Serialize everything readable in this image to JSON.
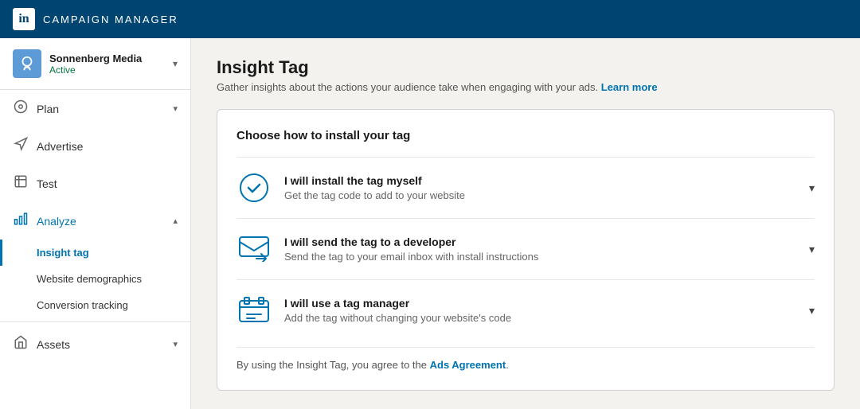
{
  "topNav": {
    "logoText": "in",
    "title": "CAMPAIGN MANAGER"
  },
  "sidebar": {
    "account": {
      "name": "Sonnenberg Media",
      "status": "Active"
    },
    "items": [
      {
        "id": "plan",
        "label": "Plan",
        "icon": "⊙",
        "hasChevron": true
      },
      {
        "id": "advertise",
        "label": "Advertise",
        "icon": "📣",
        "hasChevron": false
      },
      {
        "id": "test",
        "label": "Test",
        "icon": "⚗",
        "hasChevron": false
      },
      {
        "id": "analyze",
        "label": "Analyze",
        "icon": "📊",
        "hasChevron": true,
        "active": true
      }
    ],
    "analyzeSubItems": [
      {
        "id": "insight-tag",
        "label": "Insight tag",
        "active": true
      },
      {
        "id": "website-demographics",
        "label": "Website demographics",
        "active": false
      },
      {
        "id": "conversion-tracking",
        "label": "Conversion tracking",
        "active": false
      }
    ],
    "bottomItems": [
      {
        "id": "assets",
        "label": "Assets",
        "icon": "🏛",
        "hasChevron": true
      }
    ]
  },
  "main": {
    "title": "Insight Tag",
    "subtitle": "Gather insights about the actions your audience take when engaging with your ads.",
    "learnMoreLabel": "Learn more",
    "card": {
      "heading": "Choose how to install your tag",
      "options": [
        {
          "id": "self-install",
          "title": "I will install the tag myself",
          "description": "Get the tag code to add to your website",
          "iconType": "check-circle"
        },
        {
          "id": "send-developer",
          "title": "I will send the tag to a developer",
          "description": "Send the tag to your email inbox with install instructions",
          "iconType": "email"
        },
        {
          "id": "tag-manager",
          "title": "I will use a tag manager",
          "description": "Add the tag without changing your website's code",
          "iconType": "briefcase"
        }
      ],
      "footer": {
        "text": "By using the Insight Tag, you agree to the",
        "linkLabel": "Ads Agreement",
        "suffix": "."
      }
    }
  }
}
